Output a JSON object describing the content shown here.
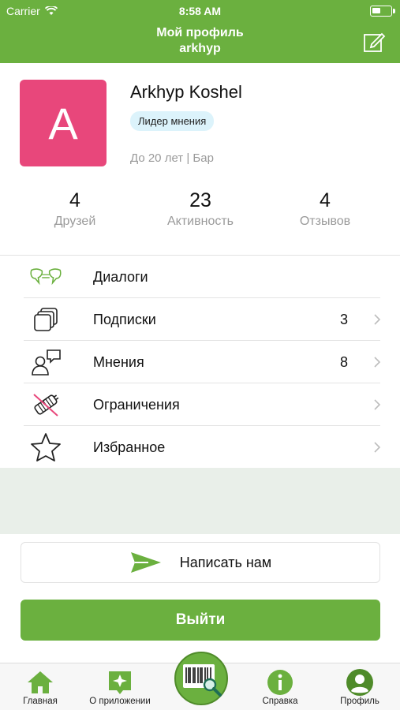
{
  "status": {
    "carrier": "Carrier",
    "time": "8:58 AM"
  },
  "nav": {
    "title": "Мой профиль",
    "subtitle": "arkhyp"
  },
  "profile": {
    "initial": "A",
    "name": "Arkhyp Koshel",
    "badge": "Лидер мнения",
    "meta": "До 20 лет | Бар",
    "avatar_color": "#e8477b"
  },
  "stats": [
    {
      "value": "4",
      "label": "Друзей"
    },
    {
      "value": "23",
      "label": "Активность"
    },
    {
      "value": "4",
      "label": "Отзывов"
    }
  ],
  "menu": [
    {
      "label": "Диалоги",
      "icon": "dialogs-icon",
      "count": ""
    },
    {
      "label": "Подписки",
      "icon": "subscriptions-icon",
      "count": "3"
    },
    {
      "label": "Мнения",
      "icon": "opinions-icon",
      "count": "8"
    },
    {
      "label": "Ограничения",
      "icon": "restrictions-icon",
      "count": ""
    },
    {
      "label": "Избранное",
      "icon": "favorites-icon",
      "count": ""
    }
  ],
  "buttons": {
    "write_us": "Написать нам",
    "logout": "Выйти"
  },
  "tabs": [
    {
      "label": "Главная",
      "icon": "home-icon"
    },
    {
      "label": "О приложении",
      "icon": "about-icon"
    },
    {
      "label": "Справка",
      "icon": "info-icon"
    },
    {
      "label": "Профиль",
      "icon": "profile-icon"
    }
  ],
  "colors": {
    "brand_green": "#6bb03f",
    "badge_bg": "#dcf3fb",
    "grey_area": "#e9efe9"
  }
}
